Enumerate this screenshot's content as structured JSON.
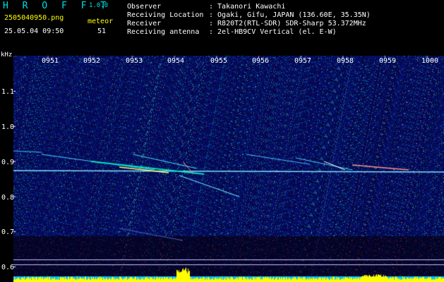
{
  "header": {
    "app_name": "H R O F F T",
    "version": "1.0.0",
    "filename": "2505040950.png",
    "datetime": "25.05.04 09:50",
    "meteor_label": "meteor",
    "meteor_count": "51"
  },
  "metadata": [
    {
      "label": "Observer",
      "value": ": Takanori Kawachi"
    },
    {
      "label": "Receiving Location",
      "value": ": Ogaki, Gifu, JAPAN (136.60E, 35.35N)"
    },
    {
      "label": "Receiver",
      "value": ": R820T2(RTL-SDR) SDR-Sharp 53.372MHz"
    },
    {
      "label": "Receiving antenna",
      "value": ": 2el-HB9CV Vertical (el. E-W)"
    }
  ],
  "spectrogram": {
    "y_unit": "kHz",
    "time_labels": [
      "0951",
      "0952",
      "0953",
      "0954",
      "0955",
      "0956",
      "0957",
      "0958",
      "0959",
      "1000"
    ],
    "freq_labels": [
      "1.1",
      "1.0",
      "0.9",
      "0.8",
      "0.7",
      "0.6"
    ],
    "colors": {
      "background": "#000000",
      "noise": "#0a1a8c",
      "signal": "#00e0e0",
      "power": "#ffff00",
      "power_base": "#00c0ff"
    }
  }
}
